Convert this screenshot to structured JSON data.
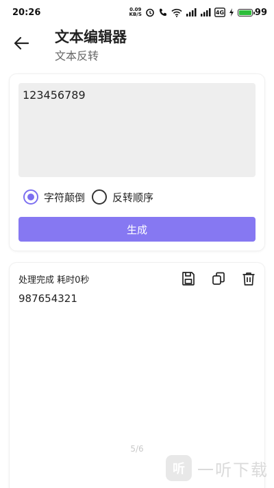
{
  "status_bar": {
    "time": "20:26",
    "net_speed_value": "0.09",
    "net_speed_unit": "KB/S",
    "network_label": "4G",
    "battery_level": "99",
    "battery_fraction": 0.99
  },
  "header": {
    "title": "文本编辑器",
    "subtitle": "文本反转"
  },
  "input": {
    "text": "123456789",
    "options": [
      {
        "label": "字符颠倒",
        "checked": true
      },
      {
        "label": "反转顺序",
        "checked": false
      }
    ],
    "generate_label": "生成"
  },
  "output": {
    "status": "处理完成 耗时0秒",
    "text": "987654321",
    "page_indicator": "5/6",
    "icons": [
      "save-icon",
      "copy-icon",
      "delete-icon"
    ]
  },
  "watermark": {
    "logo_text": "听",
    "text": "一听下载"
  },
  "colors": {
    "accent": "#8678f2",
    "radio_accent": "#7c6ff0"
  }
}
